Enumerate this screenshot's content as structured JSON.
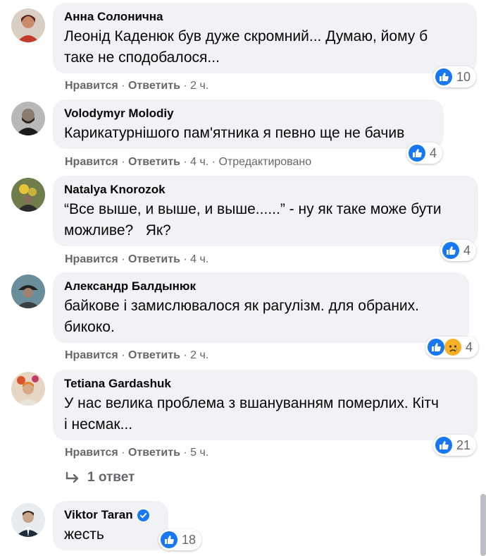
{
  "action_labels": {
    "like": "Нравится",
    "reply": "Ответить",
    "sep": " · "
  },
  "comments": [
    {
      "author": "Анна Солонична",
      "text_lines": [
        "Леонід Каденюк був дуже скромний... Думаю, йому б",
        "таке не сподобалося..."
      ],
      "time": "2 ч.",
      "reaction_count": "10",
      "reactions": [
        "like"
      ],
      "edited": ""
    },
    {
      "author": "Volodymyr Molodiy",
      "text_lines": [
        "Карикатурнішого пам'ятника я певно ще не бачив"
      ],
      "time": "4 ч.",
      "reaction_count": "4",
      "reactions": [
        "like"
      ],
      "edited": "Отредактировано"
    },
    {
      "author": "Natalya Knorozok",
      "text_lines": [
        "“Все выше, и выше, и выше......” - ну як таке може бути",
        "можливе?   Як?"
      ],
      "time": "4 ч.",
      "reaction_count": "4",
      "reactions": [
        "like"
      ],
      "edited": ""
    },
    {
      "author": "Александр Балдынюк",
      "text_lines": [
        "байкове і замислювалося як рагулізм. для обраних.",
        "бикоко."
      ],
      "time": "2 ч.",
      "reaction_count": "4",
      "reactions": [
        "like",
        "sad"
      ],
      "edited": ""
    },
    {
      "author": "Tetiana Gardashuk",
      "text_lines": [
        "У нас велика проблема з вшануванням померлих. Кітч",
        "і несмак..."
      ],
      "time": "5 ч.",
      "reaction_count": "21",
      "reactions": [
        "like"
      ],
      "edited": ""
    },
    {
      "author": "Viktor Taran",
      "text_lines": [
        "жесть"
      ],
      "time": "",
      "reaction_count": "18",
      "reactions": [
        "like"
      ],
      "edited": "",
      "verified": true
    }
  ],
  "replies_link": "1 ответ",
  "icons": {
    "like": "like-reaction-icon",
    "sad": "sad-reaction-icon",
    "reply_arrow": "reply-arrow-icon",
    "verified": "verified-badge-icon"
  },
  "colors": {
    "bubble": "#f0f2f5",
    "like_blue": "#1877f2",
    "secondary_text": "#65676b"
  }
}
